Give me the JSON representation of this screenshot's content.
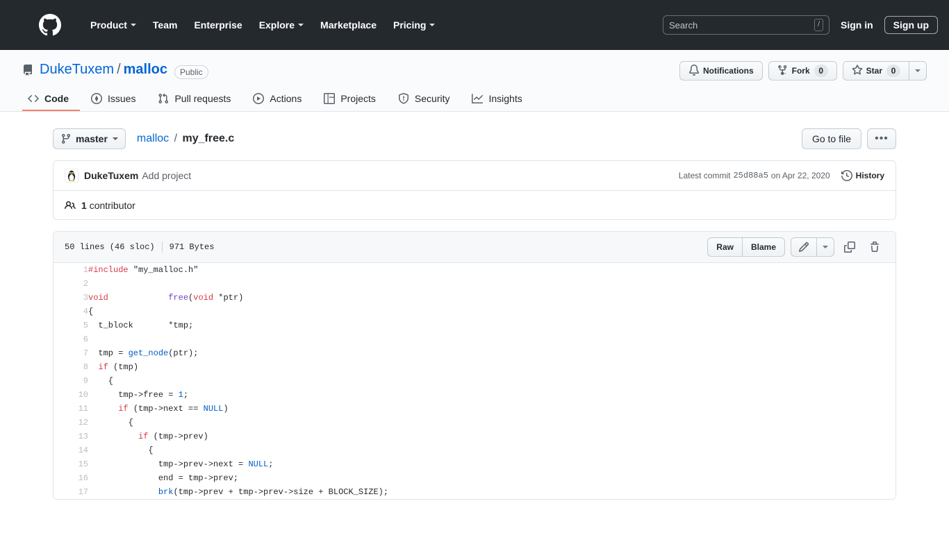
{
  "global_header": {
    "logo_icon": "github-mark-icon",
    "nav": [
      {
        "label": "Product",
        "has_caret": true
      },
      {
        "label": "Team",
        "has_caret": false
      },
      {
        "label": "Enterprise",
        "has_caret": false
      },
      {
        "label": "Explore",
        "has_caret": true
      },
      {
        "label": "Marketplace",
        "has_caret": false
      },
      {
        "label": "Pricing",
        "has_caret": true
      }
    ],
    "search": {
      "placeholder": "Search",
      "value": "",
      "shortcut_key": "/"
    },
    "sign_in_label": "Sign in",
    "sign_up_label": "Sign up",
    "background_color": "#24292e"
  },
  "repo_header": {
    "repo_icon": "repo-icon",
    "owner": "DukeTuxem",
    "separator": "/",
    "name": "malloc",
    "visibility": "Public",
    "actions": {
      "notifications_label": "Notifications",
      "notifications_icon": "bell-icon",
      "fork_label": "Fork",
      "fork_icon": "repo-forked-icon",
      "fork_count": "0",
      "star_label": "Star",
      "star_icon": "star-icon",
      "star_count": "0"
    },
    "tabs": [
      {
        "label": "Code",
        "icon": "code-icon",
        "selected": true
      },
      {
        "label": "Issues",
        "icon": "issue-opened-icon",
        "selected": false
      },
      {
        "label": "Pull requests",
        "icon": "git-pull-request-icon",
        "selected": false
      },
      {
        "label": "Actions",
        "icon": "play-icon",
        "selected": false
      },
      {
        "label": "Projects",
        "icon": "project-icon",
        "selected": false
      },
      {
        "label": "Security",
        "icon": "shield-icon",
        "selected": false
      },
      {
        "label": "Insights",
        "icon": "graph-icon",
        "selected": false
      }
    ],
    "selected_tab_underline_color": "#f9826c"
  },
  "file_nav": {
    "branch_label": "master",
    "branch_icon": "git-branch-icon",
    "breadcrumb": {
      "root": "malloc",
      "separator": "/",
      "file": "my_free.c"
    },
    "go_to_file_label": "Go to file",
    "more_options_label": "•••"
  },
  "commit_box": {
    "avatar_icon": "tux-avatar",
    "author": "DukeTuxem",
    "message": "Add project",
    "latest_commit_prefix": "Latest commit",
    "sha": "25d88a5",
    "date_text": "on Apr 22, 2020",
    "history_label": "History",
    "history_icon": "history-icon",
    "contributors_icon": "people-icon",
    "contributors_count": "1",
    "contributors_label": "contributor"
  },
  "blob": {
    "lines_text": "50 lines (46 sloc)",
    "size_text": "971 Bytes",
    "raw_label": "Raw",
    "blame_label": "Blame",
    "edit_icon": "pencil-icon",
    "edit_caret_icon": "triangle-down-icon",
    "copy_icon": "copy-icon",
    "delete_icon": "trash-icon",
    "code_lines": [
      {
        "n": "1",
        "tokens": [
          {
            "t": "#include",
            "c": "pp"
          },
          {
            "t": " ",
            "c": ""
          },
          {
            "t": "\"my_malloc.h\"",
            "c": ""
          }
        ]
      },
      {
        "n": "2",
        "tokens": []
      },
      {
        "n": "3",
        "tokens": [
          {
            "t": "void",
            "c": "k"
          },
          {
            "t": "            ",
            "c": ""
          },
          {
            "t": "free",
            "c": "fn"
          },
          {
            "t": "(",
            "c": ""
          },
          {
            "t": "void",
            "c": "k"
          },
          {
            "t": " *ptr)",
            "c": ""
          }
        ]
      },
      {
        "n": "4",
        "tokens": [
          {
            "t": "{",
            "c": ""
          }
        ]
      },
      {
        "n": "5",
        "tokens": [
          {
            "t": "  t_block       *tmp;",
            "c": ""
          }
        ]
      },
      {
        "n": "6",
        "tokens": []
      },
      {
        "n": "7",
        "tokens": [
          {
            "t": "  tmp = ",
            "c": ""
          },
          {
            "t": "get_node",
            "c": "cn"
          },
          {
            "t": "(ptr);",
            "c": ""
          }
        ]
      },
      {
        "n": "8",
        "tokens": [
          {
            "t": "  ",
            "c": ""
          },
          {
            "t": "if",
            "c": "k"
          },
          {
            "t": " (tmp)",
            "c": ""
          }
        ]
      },
      {
        "n": "9",
        "tokens": [
          {
            "t": "    {",
            "c": ""
          }
        ]
      },
      {
        "n": "10",
        "tokens": [
          {
            "t": "      tmp->free = ",
            "c": ""
          },
          {
            "t": "1",
            "c": "nu"
          },
          {
            "t": ";",
            "c": ""
          }
        ]
      },
      {
        "n": "11",
        "tokens": [
          {
            "t": "      ",
            "c": ""
          },
          {
            "t": "if",
            "c": "k"
          },
          {
            "t": " (tmp->next == ",
            "c": ""
          },
          {
            "t": "NULL",
            "c": "cn"
          },
          {
            "t": ")",
            "c": ""
          }
        ]
      },
      {
        "n": "12",
        "tokens": [
          {
            "t": "        {",
            "c": ""
          }
        ]
      },
      {
        "n": "13",
        "tokens": [
          {
            "t": "          ",
            "c": ""
          },
          {
            "t": "if",
            "c": "k"
          },
          {
            "t": " (tmp->prev)",
            "c": ""
          }
        ]
      },
      {
        "n": "14",
        "tokens": [
          {
            "t": "            {",
            "c": ""
          }
        ]
      },
      {
        "n": "15",
        "tokens": [
          {
            "t": "              tmp->prev->next = ",
            "c": ""
          },
          {
            "t": "NULL",
            "c": "cn"
          },
          {
            "t": ";",
            "c": ""
          }
        ]
      },
      {
        "n": "16",
        "tokens": [
          {
            "t": "              end = tmp->prev;",
            "c": ""
          }
        ]
      },
      {
        "n": "17",
        "tokens": [
          {
            "t": "              ",
            "c": ""
          },
          {
            "t": "brk",
            "c": "cn"
          },
          {
            "t": "(tmp->prev + tmp->prev->size + BLOCK_SIZE);",
            "c": ""
          }
        ]
      }
    ]
  },
  "colors": {
    "accent": "#0366d6",
    "header_bg": "#24292e",
    "border": "#e1e4e8",
    "muted_text": "#586069",
    "tab_underline": "#f9826c",
    "syntax_keyword": "#d73a49",
    "syntax_function": "#6f42c1",
    "syntax_constant": "#005cc5"
  }
}
